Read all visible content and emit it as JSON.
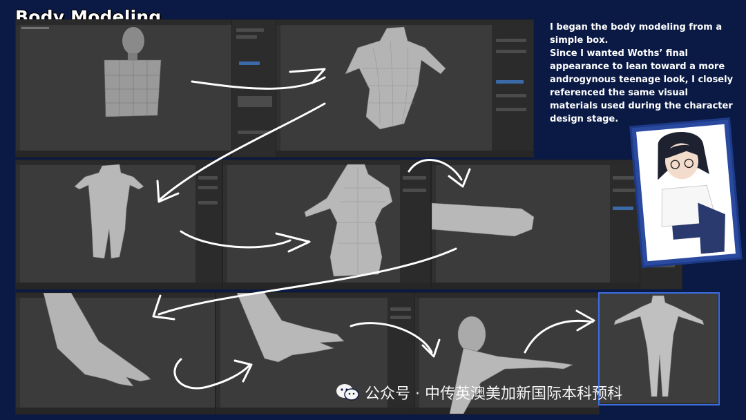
{
  "title": "Body Modeling",
  "description": [
    "I began the body modeling from a simple box.",
    "Since I wanted Woths’ final appearance to lean toward a more androgynous teenage look, I closely referenced the same visual materials used during the character design stage."
  ],
  "watermark": "公众号 · 中传英澳美加新国际本科预科",
  "icons": [
    "wechat-icon",
    "arrow-icon",
    "blender-viewport",
    "reference-illustration"
  ],
  "colors": {
    "background": "#0b1a45",
    "highlight": "#3c6ee0",
    "viewport": "#3b3b3b"
  }
}
